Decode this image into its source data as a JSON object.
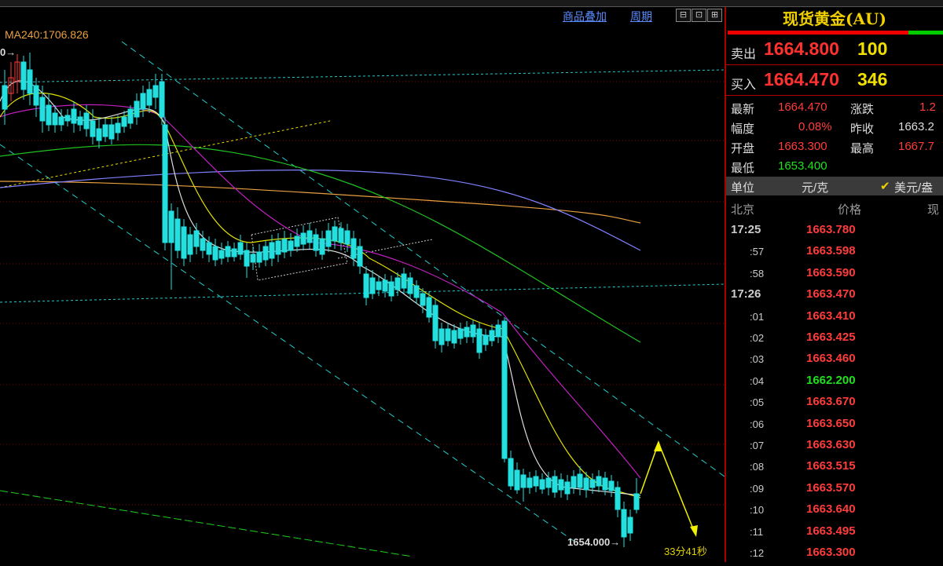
{
  "toolbar": {
    "overlay_label": "商品叠加",
    "period_label": "周期",
    "btn1": "⊟",
    "btn2": "⊡",
    "btn3": "⊞"
  },
  "indicator": {
    "ma240": "MA240:1706.826"
  },
  "labels": {
    "low_price": "1654.000",
    "top_left_tag": "0"
  },
  "countdown": "33分41秒",
  "colors": {
    "up_candle": "#ff3c3c",
    "down_candle": "#22e0e0",
    "price_red": "#ff3c3c",
    "price_green": "#20e020",
    "title_yellow": "#f0d000"
  },
  "panel": {
    "title": "现货黄金(AU)",
    "sell": {
      "label": "卖出",
      "price": "1664.800",
      "volume": "100"
    },
    "buy": {
      "label": "买入",
      "price": "1664.470",
      "volume": "346"
    },
    "stats": {
      "latest_label": "最新",
      "latest": "1664.470",
      "change_label": "涨跌",
      "change": "1.2",
      "amplitude_label": "幅度",
      "amplitude": "0.08%",
      "prev_close_label": "昨收",
      "prev_close": "1663.2",
      "open_label": "开盘",
      "open": "1663.300",
      "high_label": "最高",
      "high": "1667.7",
      "low_label": "最低",
      "low": "1653.400"
    },
    "unit": {
      "label": "单位",
      "value": "元/克",
      "check": "✔",
      "alt": "美元/盎"
    },
    "ticks_header": {
      "time": "北京",
      "price": "价格",
      "extra": "现"
    },
    "ticks": [
      {
        "time": "17:25",
        "price": "1663.780",
        "dir": "up",
        "major": true
      },
      {
        "time": ":57",
        "price": "1663.598",
        "dir": "up",
        "major": false
      },
      {
        "time": ":58",
        "price": "1663.590",
        "dir": "up",
        "major": false
      },
      {
        "time": "17:26",
        "price": "1663.470",
        "dir": "up",
        "major": true
      },
      {
        "time": ":01",
        "price": "1663.410",
        "dir": "up",
        "major": false
      },
      {
        "time": ":02",
        "price": "1663.425",
        "dir": "up",
        "major": false
      },
      {
        "time": ":03",
        "price": "1663.460",
        "dir": "up",
        "major": false
      },
      {
        "time": ":04",
        "price": "1662.200",
        "dir": "down",
        "major": false
      },
      {
        "time": ":05",
        "price": "1663.670",
        "dir": "up",
        "major": false
      },
      {
        "time": ":06",
        "price": "1663.650",
        "dir": "up",
        "major": false
      },
      {
        "time": ":07",
        "price": "1663.630",
        "dir": "up",
        "major": false
      },
      {
        "time": ":08",
        "price": "1663.515",
        "dir": "up",
        "major": false
      },
      {
        "time": ":09",
        "price": "1663.570",
        "dir": "up",
        "major": false
      },
      {
        "time": ":10",
        "price": "1663.640",
        "dir": "up",
        "major": false
      },
      {
        "time": ":11",
        "price": "1663.495",
        "dir": "up",
        "major": false
      },
      {
        "time": ":12",
        "price": "1663.300",
        "dir": "up",
        "major": false
      }
    ]
  }
}
